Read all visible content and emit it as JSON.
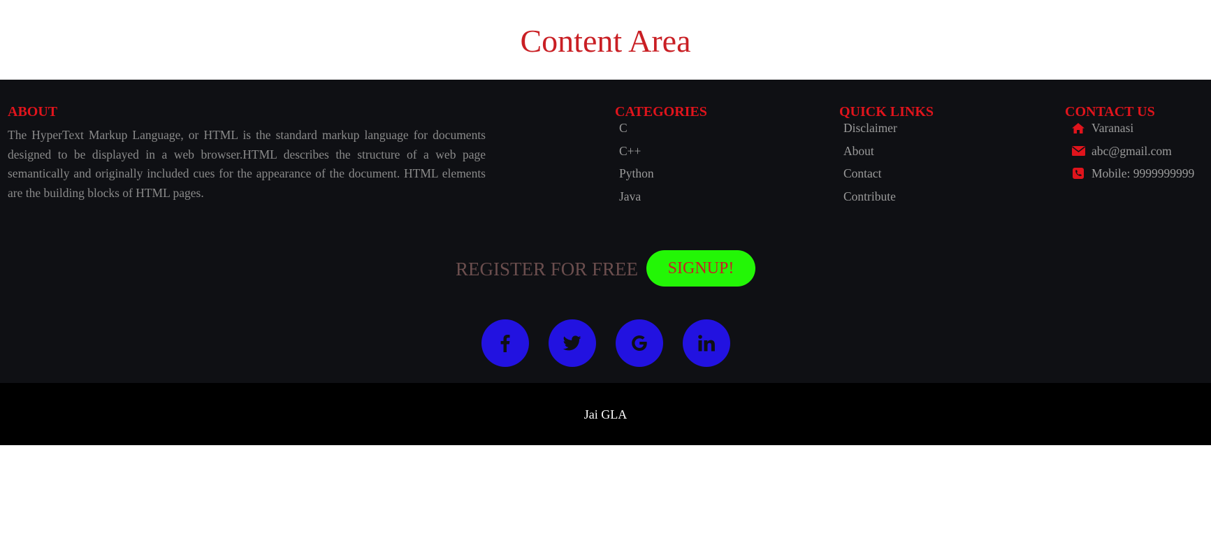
{
  "content": {
    "title": "Content Area"
  },
  "about": {
    "heading": "ABOUT",
    "text": "The HyperText Markup Language, or HTML is the standard markup language for documents designed to be displayed in a web browser.HTML describes the structure of a web page semantically and originally included cues for the appearance of the document. HTML elements are the building blocks of HTML pages."
  },
  "categories": {
    "heading": "CATEGORIES",
    "items": [
      "C",
      "C++",
      "Python",
      "Java"
    ]
  },
  "quick_links": {
    "heading": "QUICK LINKS",
    "items": [
      "Disclaimer",
      "About",
      "Contact",
      "Contribute"
    ]
  },
  "contact": {
    "heading": "CONTACT US",
    "items": [
      {
        "icon": "home-icon",
        "text": "Varanasi"
      },
      {
        "icon": "envelope-icon",
        "text": "abc@gmail.com"
      },
      {
        "icon": "phone-icon",
        "text": "Mobile: 9999999999"
      }
    ]
  },
  "register": {
    "text": "REGISTER FOR FREE",
    "button_label": "SIGNUP!"
  },
  "social": {
    "icons": [
      "facebook-icon",
      "twitter-icon",
      "google-icon",
      "linkedin-icon"
    ]
  },
  "bottom": {
    "text": "Jai GLA"
  },
  "colors": {
    "accent_red": "#e0141c",
    "signup_green": "#23f606",
    "social_blue": "#2212e0",
    "footer_bg": "#0f1014"
  }
}
